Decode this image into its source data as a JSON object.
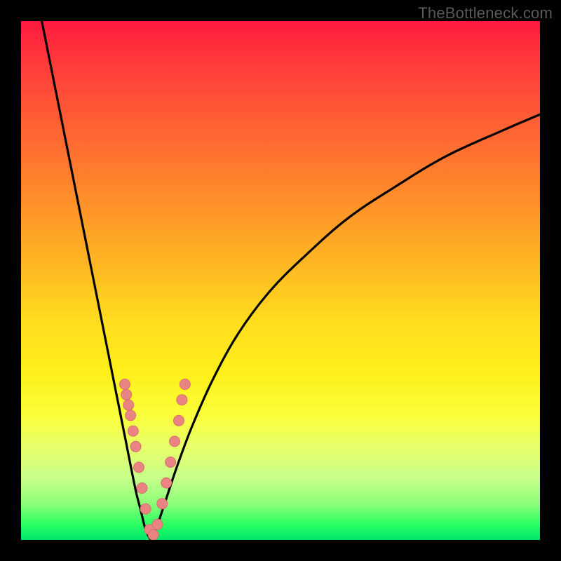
{
  "watermark": {
    "text": "TheBottleneck.com"
  },
  "colors": {
    "frame": "#000000",
    "curve": "#000000",
    "marker_fill": "#e98482",
    "marker_stroke": "#d86f6d"
  },
  "chart_data": {
    "type": "line",
    "title": "",
    "xlabel": "",
    "ylabel": "",
    "xlim": [
      0,
      100
    ],
    "ylim": [
      0,
      100
    ],
    "notes": "V-shaped bottleneck curve; minimum near x≈25. Background gradient encodes severity (red=high, green=low). Axes are unlabeled in the source image; values are in percent of axis range.",
    "series": [
      {
        "name": "left-branch",
        "x": [
          4,
          6,
          8,
          10,
          12,
          14,
          16,
          18,
          20,
          22,
          23,
          24,
          25
        ],
        "y": [
          100,
          90,
          80,
          70,
          60,
          50,
          40,
          30,
          20,
          10,
          6,
          2,
          0
        ]
      },
      {
        "name": "right-branch",
        "x": [
          25,
          26,
          27,
          28,
          30,
          33,
          37,
          42,
          48,
          55,
          63,
          72,
          82,
          93,
          100
        ],
        "y": [
          0,
          2,
          5,
          8,
          14,
          22,
          31,
          40,
          48,
          55,
          62,
          68,
          74,
          79,
          82
        ]
      }
    ],
    "markers": {
      "name": "data-points",
      "x": [
        20.0,
        20.3,
        20.7,
        21.1,
        21.6,
        22.1,
        22.7,
        23.3,
        24.0,
        24.8,
        25.5,
        26.3,
        27.2,
        28.0,
        28.8,
        29.6,
        30.4,
        31.0,
        31.6
      ],
      "y": [
        30,
        28,
        26,
        24,
        21,
        18,
        14,
        10,
        6,
        2,
        1,
        3,
        7,
        11,
        15,
        19,
        23,
        27,
        30
      ]
    }
  }
}
